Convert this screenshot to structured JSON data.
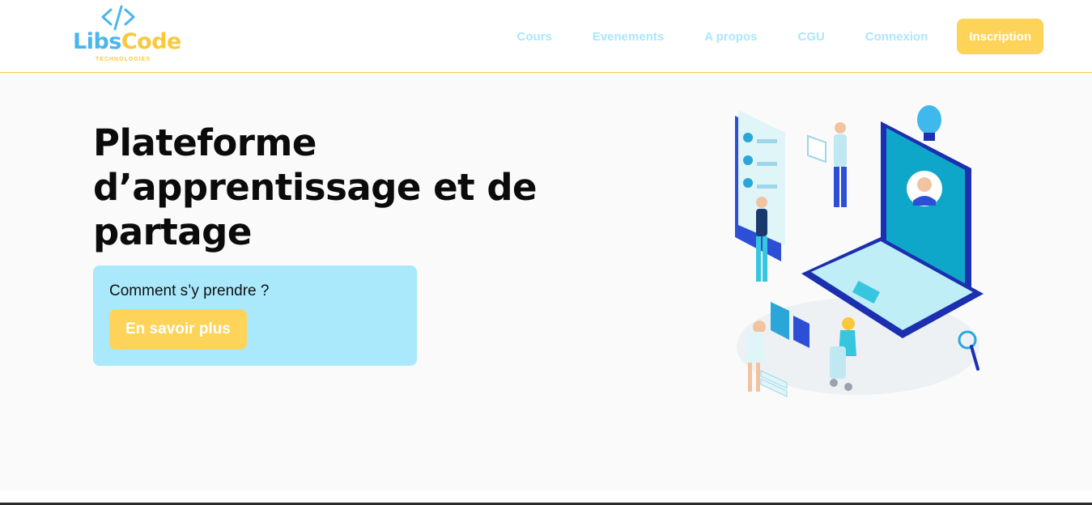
{
  "brand": {
    "name_part1": "Libs",
    "name_part2": "Code",
    "tagline": "TECHNOLOGIES",
    "icon": "code-brackets-icon"
  },
  "nav": {
    "items": [
      {
        "label": "Cours"
      },
      {
        "label": "Evenements"
      },
      {
        "label": "A propos"
      },
      {
        "label": "CGU"
      },
      {
        "label": "Connexion"
      }
    ],
    "signup_label": "Inscription"
  },
  "hero": {
    "title": "Plateforme d’apprentissage et de partage",
    "cta_question": "Comment s’y prendre ?",
    "cta_button": "En savoir plus",
    "illustration": "e-learning-illustration"
  },
  "colors": {
    "primary_blue": "#4ab6ef",
    "light_blue": "#aae9fc",
    "yellow": "#fdd459",
    "nav_text": "#a9e8fb"
  }
}
